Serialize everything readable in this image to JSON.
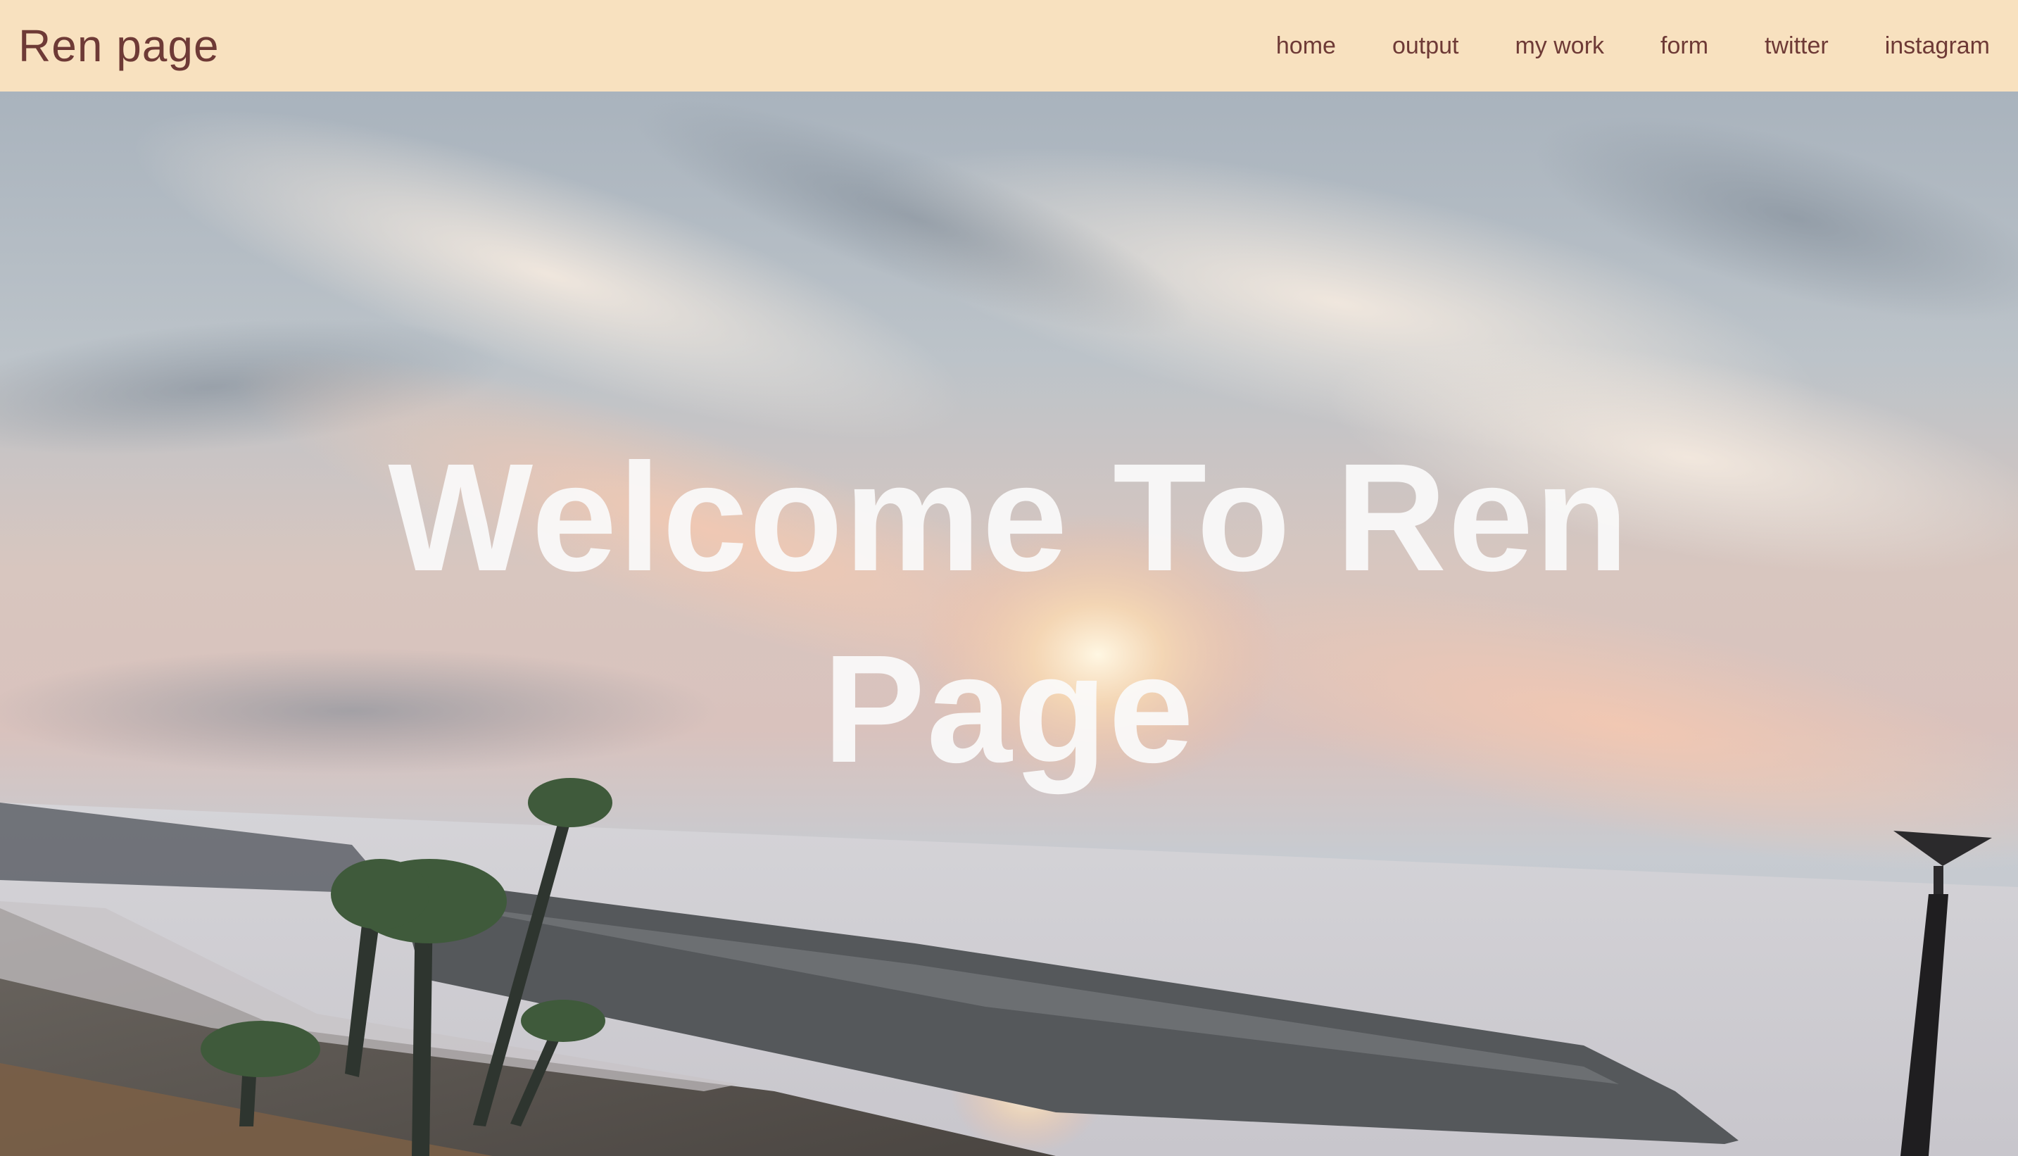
{
  "header": {
    "brand": "Ren page",
    "nav": [
      {
        "label": "home"
      },
      {
        "label": "output"
      },
      {
        "label": "my work"
      },
      {
        "label": "form"
      },
      {
        "label": "twitter"
      },
      {
        "label": "instagram"
      }
    ]
  },
  "hero": {
    "title_line1": "Welcome To Ren",
    "title_line2": "Page",
    "image_description": "",
    "colors": {
      "header_bg": "#f8e1bf",
      "header_text": "#6e3a36",
      "title_text": "#fafafa"
    }
  }
}
